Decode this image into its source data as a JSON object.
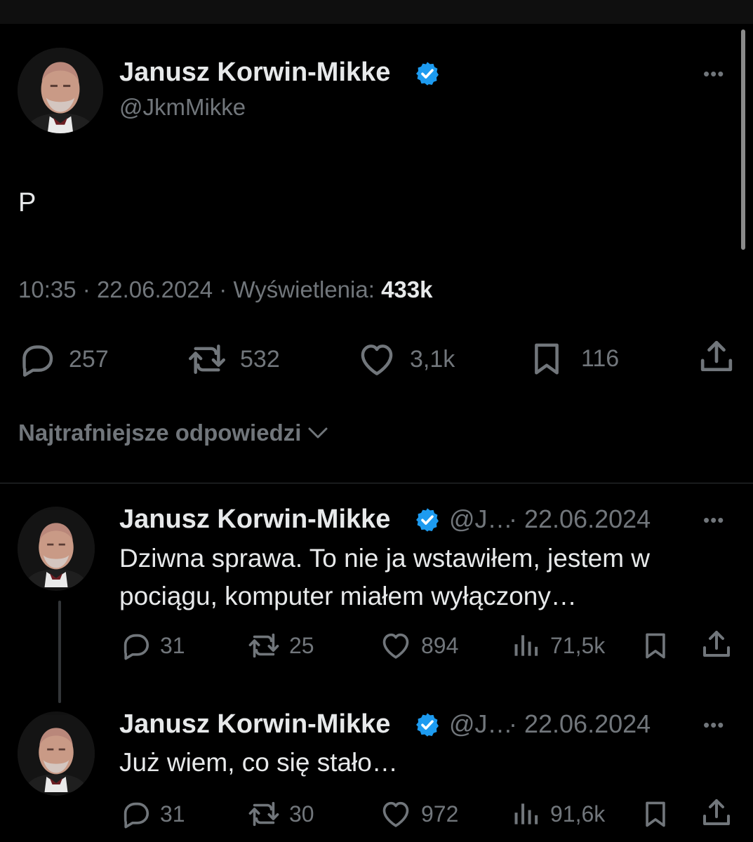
{
  "main_tweet": {
    "author_name": "Janusz Korwin-Mikke",
    "handle": "@JkmMikke",
    "text": "P",
    "time": "10:35",
    "date": "22.06.2024",
    "views_label": "Wyświetlenia:",
    "views_value": "433k",
    "replies": "257",
    "retweets": "532",
    "likes": "3,1k",
    "bookmarks": "116",
    "more": "•••"
  },
  "sort_label": "Najtrafniejsze odpowiedzi",
  "replies": [
    {
      "author_name": "Janusz Korwin-Mikke",
      "handle": "@J…",
      "date": "· 22.06.2024",
      "text_line1": "Dziwna sprawa. To nie ja wstawiłem, jestem w",
      "text_line2": "pociągu, komputer miałem wyłączony…",
      "replies": "31",
      "retweets": "25",
      "likes": "894",
      "views": "71,5k",
      "more": "•••"
    },
    {
      "author_name": "Janusz Korwin-Mikke",
      "handle": "@J…",
      "date": "· 22.06.2024",
      "text_line1": "Już wiem, co się stało…",
      "replies": "31",
      "retweets": "30",
      "likes": "972",
      "views": "91,6k",
      "more": "•••"
    }
  ],
  "icons": {
    "reply": "speech-bubble-icon",
    "retweet": "retweet-arrows-icon",
    "like": "heart-icon",
    "bookmark": "bookmark-icon",
    "share": "share-upload-icon",
    "views": "bar-chart-icon",
    "verified": "verified-badge-icon",
    "chevron": "chevron-down-icon"
  },
  "colors": {
    "background": "#000000",
    "text": "#e7e9ea",
    "muted": "#71767b",
    "verified": "#1d9bf0"
  }
}
